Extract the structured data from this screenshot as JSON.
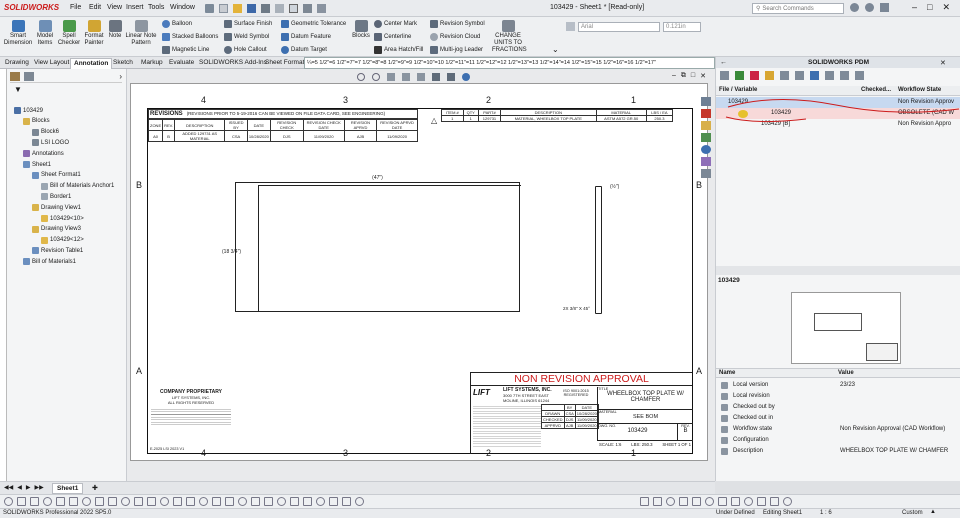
{
  "app": {
    "brand": "SOLIDWORKS",
    "window_title": "103429 - Sheet1 * [Read-only]",
    "search_placeholder": "Search Commands"
  },
  "menu": [
    "File",
    "Edit",
    "View",
    "Insert",
    "Tools",
    "Window"
  ],
  "ribbon": {
    "large": [
      "Smart Dimension",
      "Model Items",
      "Spell Checker",
      "Format Painter",
      "Note",
      "Linear Note Pattern"
    ],
    "col1": [
      "Balloon",
      "Stacked Balloons",
      "Magnetic Line"
    ],
    "col2": [
      "Surface Finish",
      "Weld Symbol",
      "Hole Callout"
    ],
    "col3": [
      "Geometric Tolerance",
      "Datum Feature",
      "Datum Target"
    ],
    "blocks": "Blocks",
    "col4": [
      "Center Mark",
      "Centerline",
      "Area Hatch/Fill"
    ],
    "col5": [
      "Revision Symbol",
      "Revision Cloud",
      "Multi-jog Leader"
    ],
    "change_units": "CHANGE UNITS TO FRACTIONS",
    "font_name": "Arial",
    "font_size": "0.121in"
  },
  "tabs": [
    "Drawing",
    "View Layout",
    "Annotation",
    "Sketch",
    "Markup",
    "Evaluate",
    "SOLIDWORKS Add-Ins",
    "Sheet Format"
  ],
  "active_tab": "Annotation",
  "ruler_text": "¼=5 1/2\"=6 1/2\"=7\"=7 1/2\"=8\"=8 1/2\"=9\"=9 1/2\"=10\"=10 1/2\"=11\"=11 1/2\"=12\"=12 1/2\"=13\"=13 1/2\"=14\"=14 1/2\"=15\"=15 1/2\"=16\"=16 1/2\"=17\"",
  "tree": [
    {
      "label": "103429",
      "indent": 0,
      "icon": "drawing-icon"
    },
    {
      "label": "Blocks",
      "indent": 1,
      "icon": "folder-icon"
    },
    {
      "label": "Block6",
      "indent": 2,
      "icon": "block-icon"
    },
    {
      "label": "LSI LOGO",
      "indent": 2,
      "icon": "block-icon"
    },
    {
      "label": "Annotations",
      "indent": 1,
      "icon": "annotation-icon"
    },
    {
      "label": "Sheet1",
      "indent": 1,
      "icon": "sheet-icon"
    },
    {
      "label": "Sheet Format1",
      "indent": 2,
      "icon": "sheet-format-icon"
    },
    {
      "label": "Bill of Materials Anchor1",
      "indent": 3,
      "icon": "anchor-icon"
    },
    {
      "label": "Border1",
      "indent": 3,
      "icon": "border-icon"
    },
    {
      "label": "Drawing View1",
      "indent": 2,
      "icon": "view-icon"
    },
    {
      "label": "103429<10>",
      "indent": 3,
      "icon": "part-icon"
    },
    {
      "label": "Drawing View3",
      "indent": 2,
      "icon": "view-icon"
    },
    {
      "label": "103429<12>",
      "indent": 3,
      "icon": "part-icon"
    },
    {
      "label": "Revision Table1",
      "indent": 2,
      "icon": "table-icon"
    },
    {
      "label": "Bill of Materials1",
      "indent": 1,
      "icon": "table-icon"
    }
  ],
  "sheet": {
    "zone_cols": [
      "4",
      "3",
      "2",
      "1"
    ],
    "zone_rows": [
      "B",
      "A"
    ],
    "revisions_title": "REVISIONS",
    "revisions_note": "(REVISIONS PRIOR TO 5-19-2016 CAN BE VIEWED ON FILE DATA CARD, SEE ENGINEERING)",
    "rev_headers": [
      "ZONE",
      "REV.",
      "DESCRIPTION",
      "ISSUED BY",
      "DATE",
      "REVISION CHECK",
      "REVISION CHECK DATE",
      "REVISION APRVD",
      "REVISION APRVD DATE"
    ],
    "rev_row": [
      "A0",
      "B",
      "ADDED 129731 AS MATERIAL",
      "CSA",
      "10/28/2020",
      "DJS",
      "11/09/2020",
      "AJB",
      "11/09/2020"
    ],
    "bom_headers": [
      "ITEM #",
      "QTY",
      "PART#",
      "DESCRIPTION",
      "MATERIAL",
      "LBS / EA"
    ],
    "bom_row": [
      "1",
      "1",
      "129731",
      "MATERIAL, WHEELBOX TOP PLATE",
      "ASTM A572 GR.50",
      "250.3"
    ],
    "dim_length": "(47\")",
    "dim_height": "(18 3/4\")",
    "dim_thickness": "(½\")",
    "chamfer_note": "2X 3/8\" X 45°",
    "proprietary_title": "COMPANY PROPRIETARY",
    "proprietary_sub": "LIFT SYSTEMS, INC.",
    "proprietary_rights": "ALL RIGHTS RESERVED",
    "form_code": "E-2025 LSI 2023 V1",
    "non_revision": "NON REVISION APPROVAL",
    "company": "LIFT SYSTEMS, INC.",
    "company_addr": "3000 7TH STREET EAST MOLINE, ILLINOIS 61244",
    "iso": "ISO 9001:2015 REGISTERED",
    "logo_text": "LIFT",
    "title_label": "TITLE",
    "part_title": "WHEELBOX TOP PLATE W/ CHAMFER",
    "material_label": "MATERIAL",
    "material_value": "SEE BOM",
    "dwg_no_label": "DWG. NO.",
    "dwg_no": "103429",
    "rev_label": "REV.",
    "rev_value": "B",
    "scale": "SCALE: 1:6",
    "lbs": "LBS: 250.3",
    "sheet_of": "SHEET 1 OF 1",
    "title_grid": [
      [
        "BY",
        "DATE"
      ],
      [
        "CSA",
        "10/28/2020"
      ],
      [
        "DJS",
        "11/09/2020"
      ],
      [
        "AJB",
        "11/09/2020"
      ]
    ],
    "title_grid_labels": [
      "DRAWN",
      "CHECKED",
      "APPRVD"
    ]
  },
  "right_panel": {
    "title": "SOLIDWORKS PDM",
    "col_file": "File / Variable",
    "col_checked": "Checked...",
    "col_workflow": "Workflow State",
    "rows": [
      {
        "name": "103429",
        "state": "Non Revision Approv"
      },
      {
        "name": "103429",
        "state": "OBSOLETE (CAD W"
      },
      {
        "name": "103429 [B]",
        "state": "Non Revision Appro"
      }
    ],
    "preview_label": "103429",
    "prop_name": "Name",
    "prop_value": "Value",
    "props": [
      {
        "name": "Local version",
        "value": "23/23"
      },
      {
        "name": "Local revision",
        "value": ""
      },
      {
        "name": "Checked out by",
        "value": ""
      },
      {
        "name": "Checked out in",
        "value": ""
      },
      {
        "name": "Workflow state",
        "value": "Non Revision Approval (CAD Workflow)"
      },
      {
        "name": "Configuration",
        "value": ""
      },
      {
        "name": "Description",
        "value": "WHEELBOX TOP PLATE W/ CHAMFER"
      }
    ]
  },
  "sheet_tab": "Sheet1",
  "status": {
    "product": "SOLIDWORKS Professional 2022 SP5.0",
    "under_defined": "Under Defined",
    "editing": "Editing Sheet1",
    "scale": "1 : 6",
    "units": "Custom"
  },
  "colors": {
    "accent": "#cc1b1b",
    "selection": "#c7d9f0",
    "pdm_header": "#dfe3e8"
  }
}
